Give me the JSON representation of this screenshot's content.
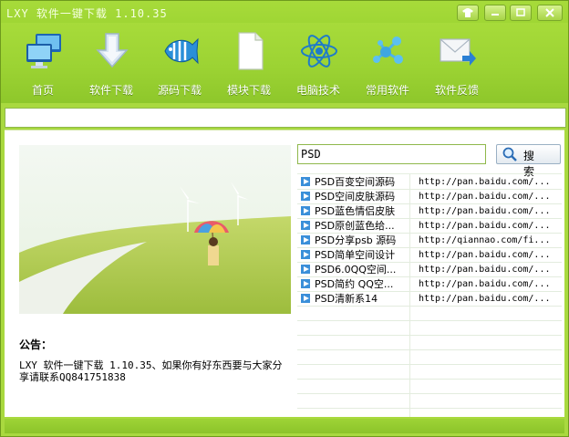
{
  "window": {
    "title": "LXY 软件一键下载 1.10.35",
    "controls": [
      "shirt-icon",
      "minimize-icon",
      "maximize-icon",
      "close-icon"
    ]
  },
  "toolbar": {
    "items": [
      {
        "label": "首页",
        "icon": "monitors-icon"
      },
      {
        "label": "软件下载",
        "icon": "download-arrow-icon"
      },
      {
        "label": "源码下载",
        "icon": "fish-icon"
      },
      {
        "label": "模块下载",
        "icon": "document-icon"
      },
      {
        "label": "电脑技术",
        "icon": "atom-icon"
      },
      {
        "label": "常用软件",
        "icon": "molecule-icon"
      },
      {
        "label": "软件反馈",
        "icon": "mail-arrow-icon"
      }
    ]
  },
  "notice": {
    "title": "公告：",
    "text": "LXY 软件一键下载 1.10.35、如果你有好东西要与大家分享请联系QQ841751838"
  },
  "search": {
    "value": "PSD",
    "button_label": "搜 索"
  },
  "results": [
    {
      "name": "PSD百变空间源码",
      "url": "http://pan.baidu.com/..."
    },
    {
      "name": "PSD空间皮肤源码",
      "url": "http://pan.baidu.com/..."
    },
    {
      "name": "PSD蓝色情侣皮肤",
      "url": "http://pan.baidu.com/..."
    },
    {
      "name": "PSD原创蓝色给...",
      "url": "http://pan.baidu.com/..."
    },
    {
      "name": "PSD分享psb 源码",
      "url": "http://qiannao.com/fi..."
    },
    {
      "name": "PSD简单空间设计",
      "url": "http://pan.baidu.com/..."
    },
    {
      "name": "PSD6.0QQ空间...",
      "url": "http://pan.baidu.com/..."
    },
    {
      "name": "PSD简约 QQ空...",
      "url": "http://pan.baidu.com/..."
    },
    {
      "name": "PSD清新系14",
      "url": "http://pan.baidu.com/..."
    }
  ],
  "colors": {
    "theme": "#a4d83a",
    "accent_blue": "#2a7fd4"
  }
}
